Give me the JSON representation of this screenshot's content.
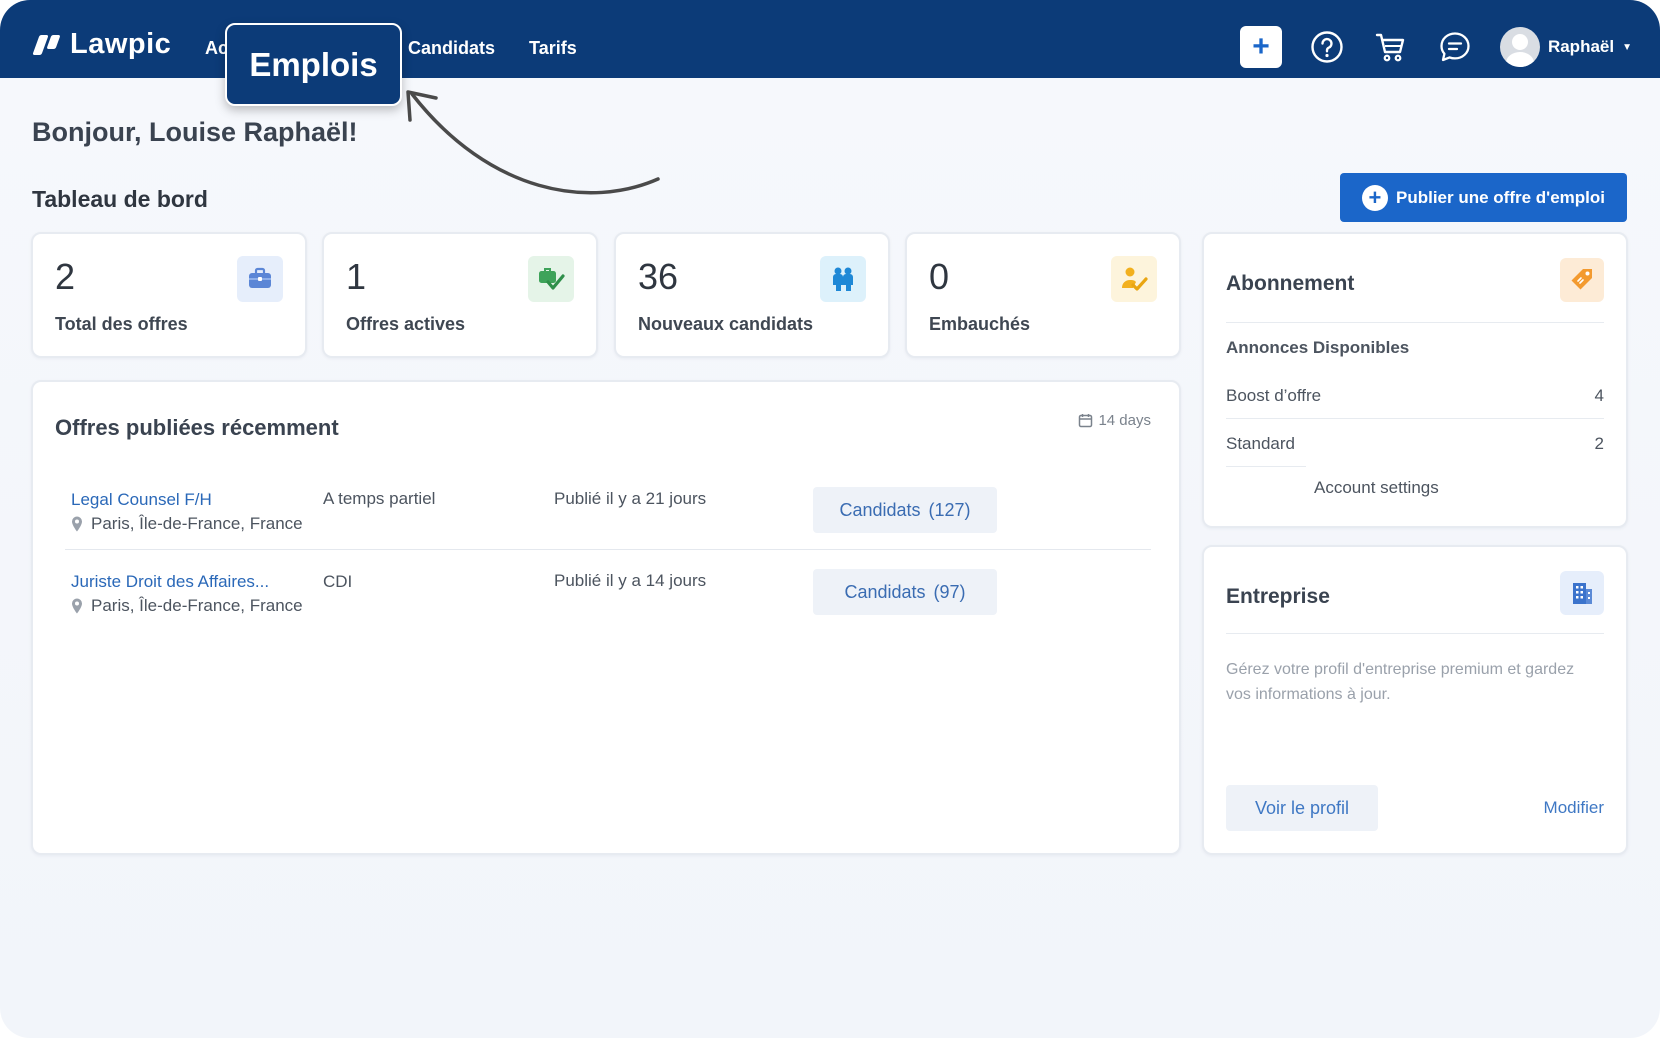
{
  "navbar": {
    "logo_text": "Lawpic",
    "links": [
      "Ac",
      "Candidats",
      "Tarifs"
    ],
    "user_name": "Raphaël"
  },
  "tooltip": {
    "label": "Emplois"
  },
  "greeting": "Bonjour, Louise Raphaël!",
  "dashboard": {
    "title": "Tableau de bord",
    "publish_label": "Publier une offre d'emploi",
    "stats": [
      {
        "value": "2",
        "label": "Total des offres",
        "icon": "briefcase-icon",
        "color": "#5b86d6",
        "bg": "#e6eefb"
      },
      {
        "value": "1",
        "label": "Offres actives",
        "icon": "check-briefcase-icon",
        "color": "#3ea35a",
        "bg": "#e5f4e8"
      },
      {
        "value": "36",
        "label": "Nouveaux candidats",
        "icon": "people-icon",
        "color": "#1e88d6",
        "bg": "#ddf1fb"
      },
      {
        "value": "0",
        "label": "Embauchés",
        "icon": "hired-icon",
        "color": "#f2b01e",
        "bg": "#fdf4dc"
      }
    ]
  },
  "offers": {
    "title": "Offres publiées récemment",
    "range": "14 days",
    "rows": [
      {
        "title": "Legal Counsel F/H",
        "location": "Paris, Île-de-France, France",
        "type": "A temps partiel",
        "published": "Publié il y a 21 jours",
        "cand_label": "Candidats",
        "cand_count": "(127)"
      },
      {
        "title": "Juriste Droit des Affaires...",
        "location": "Paris, Île-de-France, France",
        "type": "CDI",
        "published": "Publié il y a 14 jours",
        "cand_label": "Candidats",
        "cand_count": "(97)"
      }
    ]
  },
  "subscription": {
    "title": "Abonnement",
    "icon_color": "#f39a2f",
    "subtitle": "Annonces Disponibles",
    "items": [
      {
        "label": "Boost d’offre",
        "value": "4"
      },
      {
        "label": "Standard",
        "value": "2"
      }
    ],
    "account_settings": "Account settings"
  },
  "company": {
    "title": "Entreprise",
    "description": "Gérez votre profil d'entreprise premium et gardez vos informations à jour.",
    "view_label": "Voir le profil",
    "edit_label": "Modifier"
  }
}
